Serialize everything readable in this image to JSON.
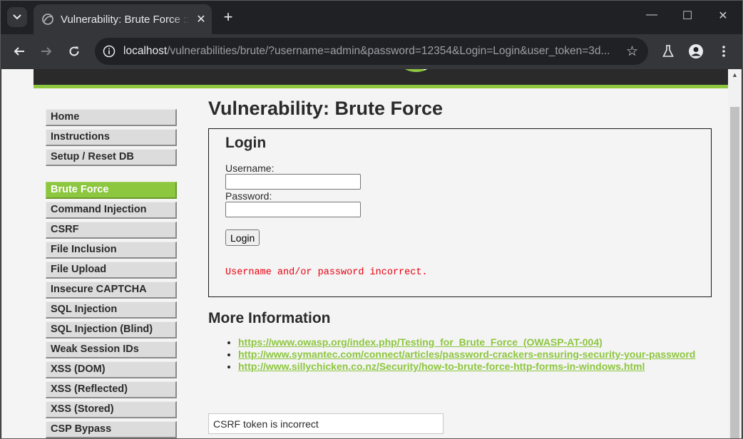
{
  "browser": {
    "tab_title": "Vulnerability: Brute Force :: Damn Vulnerable Web Application (DVWA)",
    "url_host": "localhost",
    "url_path": "/vulnerabilities/brute/?username=admin&password=12354&Login=Login&user_token=3d...",
    "icons": {
      "tab_search": "chevron-down-icon",
      "favicon": "dvwa-favicon",
      "close": "close-icon",
      "new_tab": "plus-icon",
      "back": "back-arrow-icon",
      "forward": "forward-arrow-icon",
      "reload": "reload-icon",
      "site_info": "info-icon",
      "bookmark": "star-icon",
      "labs": "flask-icon",
      "profile": "person-icon",
      "menu": "kebab-menu-icon"
    }
  },
  "sidebar": {
    "group1": [
      "Home",
      "Instructions",
      "Setup / Reset DB"
    ],
    "group2": [
      "Brute Force",
      "Command Injection",
      "CSRF",
      "File Inclusion",
      "File Upload",
      "Insecure CAPTCHA",
      "SQL Injection",
      "SQL Injection (Blind)",
      "Weak Session IDs",
      "XSS (DOM)",
      "XSS (Reflected)",
      "XSS (Stored)",
      "CSP Bypass"
    ],
    "active": "Brute Force"
  },
  "main": {
    "title": "Vulnerability: Brute Force",
    "login": {
      "heading": "Login",
      "username_label": "Username:",
      "username_value": "",
      "password_label": "Password:",
      "password_value": "",
      "button": "Login",
      "error": "Username and/or password incorrect."
    },
    "more_info": {
      "heading": "More Information",
      "links": [
        "https://www.owasp.org/index.php/Testing_for_Brute_Force_(OWASP-AT-004)",
        "http://www.symantec.com/connect/articles/password-crackers-ensuring-security-your-password",
        "http://www.sillychicken.co.nz/Security/how-to-brute-force-http-forms-in-windows.html"
      ]
    },
    "csrf_message": "CSRF token is incorrect"
  },
  "colors": {
    "accent_green": "#8dc63f",
    "error_red": "#e8000f",
    "chrome_dark": "#202124",
    "chrome_toolbar": "#35363a"
  }
}
